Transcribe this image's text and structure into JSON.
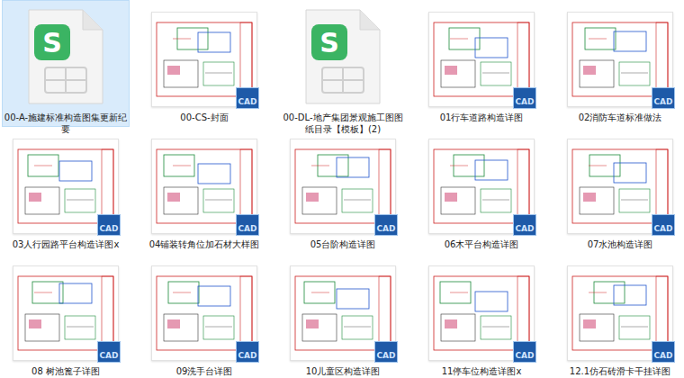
{
  "badge": "CAD",
  "logo": "S",
  "files": [
    {
      "name": "00-A-施建标准构造图集更新纪要",
      "kind": "wps",
      "selected": true
    },
    {
      "name": "00-CS-封面",
      "kind": "cad",
      "selected": false
    },
    {
      "name": "00-DL-地产集团景观施工图图纸目录【模板】(2)",
      "kind": "wps",
      "selected": false
    },
    {
      "name": "01行车道路构造详图",
      "kind": "cad",
      "selected": false
    },
    {
      "name": "02消防车道标准做法",
      "kind": "cad",
      "selected": false
    },
    {
      "name": "03人行园路平台构造详图x",
      "kind": "cad",
      "selected": false
    },
    {
      "name": "04铺装转角位加石材大样图",
      "kind": "cad",
      "selected": false
    },
    {
      "name": "05台阶构造详图",
      "kind": "cad",
      "selected": false
    },
    {
      "name": "06木平台构造详图",
      "kind": "cad",
      "selected": false
    },
    {
      "name": "07水池构造详图",
      "kind": "cad",
      "selected": false
    },
    {
      "name": "08 树池篦子详图",
      "kind": "cad",
      "selected": false
    },
    {
      "name": "09洗手台详图",
      "kind": "cad",
      "selected": false
    },
    {
      "name": "10儿童区构造详图",
      "kind": "cad",
      "selected": false
    },
    {
      "name": "11停车位构造详图x",
      "kind": "cad",
      "selected": false
    },
    {
      "name": "12.1仿石砖滑卡干挂详图",
      "kind": "cad",
      "selected": false
    }
  ]
}
